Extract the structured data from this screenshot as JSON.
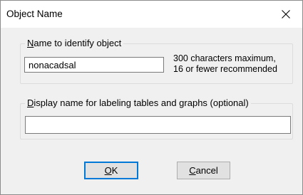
{
  "window": {
    "title": "Object Name",
    "close_icon": "close-icon"
  },
  "name_group": {
    "label_access_key": "N",
    "label_rest": "ame to identify object",
    "input_value": "nonacadsal",
    "hint_line1": "300 characters maximum,",
    "hint_line2": "16 or fewer recommended"
  },
  "display_group": {
    "label_access_key": "D",
    "label_rest": "isplay name for labeling tables and graphs  (optional)",
    "input_value": ""
  },
  "buttons": {
    "ok_access_key": "O",
    "ok_rest": "K",
    "cancel_access_key": "C",
    "cancel_rest": "ancel"
  },
  "colors": {
    "default_button_border": "#0078d7",
    "dialog_background": "#f0f0f0"
  }
}
